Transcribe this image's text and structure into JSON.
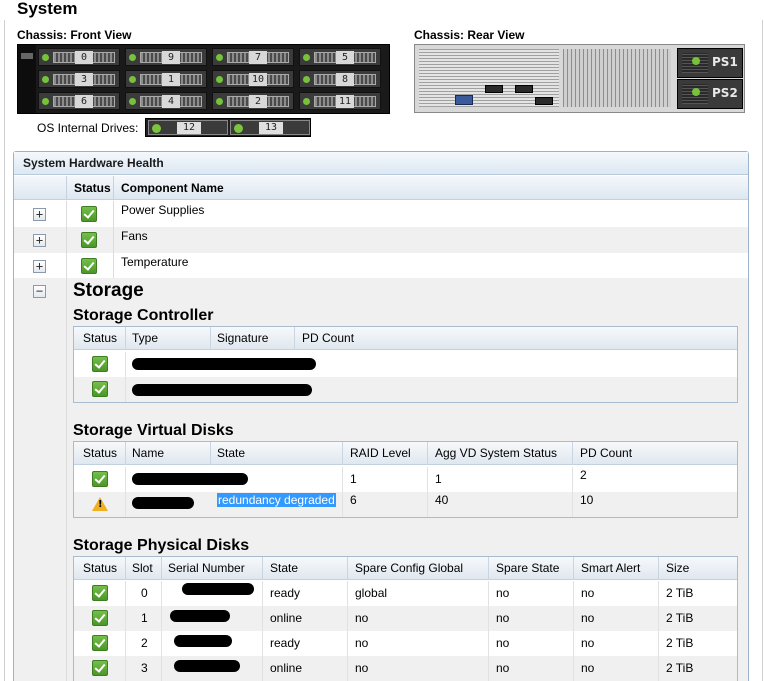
{
  "title": "System",
  "chassis": {
    "front_label": "Chassis: Front View",
    "rear_label": "Chassis: Rear View",
    "os_drives_label": "OS Internal Drives:",
    "front_bays": [
      "0",
      "3",
      "6",
      "9",
      "1",
      "4",
      "7",
      "10",
      "2",
      "5",
      "8",
      "11"
    ],
    "os_bays": [
      "12",
      "13"
    ],
    "psu": [
      "PS1",
      "PS2"
    ]
  },
  "health": {
    "title": "System Hardware Health",
    "columns": {
      "status": "Status",
      "component": "Component Name"
    },
    "rows": [
      {
        "expander": "+",
        "status": "ok",
        "name": "Power Supplies"
      },
      {
        "expander": "+",
        "status": "ok",
        "name": "Fans"
      },
      {
        "expander": "+",
        "status": "ok",
        "name": "Temperature"
      }
    ],
    "storage": {
      "expander": "−",
      "title": "Storage",
      "controller": {
        "title": "Storage Controller",
        "columns": [
          "Status",
          "Type",
          "Signature",
          "PD Count"
        ],
        "rows": [
          {
            "status": "ok"
          },
          {
            "status": "ok"
          }
        ]
      },
      "virtual_disks": {
        "title": "Storage Virtual Disks",
        "columns": [
          "Status",
          "Name",
          "State",
          "RAID Level",
          "Agg VD System Status",
          "PD Count"
        ],
        "rows": [
          {
            "status": "ok",
            "state": "",
            "raid": "1",
            "agg": "1",
            "pd": "2"
          },
          {
            "status": "warning",
            "state": "redundancy degraded",
            "raid": "6",
            "agg": "40",
            "pd": "10"
          }
        ]
      },
      "physical_disks": {
        "title": "Storage Physical Disks",
        "columns": [
          "Status",
          "Slot",
          "Serial Number",
          "State",
          "Spare Config Global",
          "Spare State",
          "Smart Alert",
          "Size"
        ],
        "rows": [
          {
            "status": "ok",
            "slot": "0",
            "state": "ready",
            "spare_global": "global",
            "spare_state": "no",
            "smart": "no",
            "size": "2 TiB"
          },
          {
            "status": "ok",
            "slot": "1",
            "state": "online",
            "spare_global": "no",
            "spare_state": "no",
            "smart": "no",
            "size": "2 TiB"
          },
          {
            "status": "ok",
            "slot": "2",
            "state": "ready",
            "spare_global": "no",
            "spare_state": "no",
            "smart": "no",
            "size": "2 TiB"
          },
          {
            "status": "ok",
            "slot": "3",
            "state": "online",
            "spare_global": "no",
            "spare_state": "no",
            "smart": "no",
            "size": "2 TiB"
          }
        ]
      }
    }
  },
  "colors": {
    "ok": "#5aa832",
    "warning": "#f0b022",
    "selection": "#3399ff",
    "header_bg": "#dde7f0"
  },
  "icons": {
    "ok": "checkmark-ok-icon",
    "warning": "warning-triangle-icon",
    "expand": "plus-expander-icon",
    "collapse": "minus-expander-icon"
  }
}
